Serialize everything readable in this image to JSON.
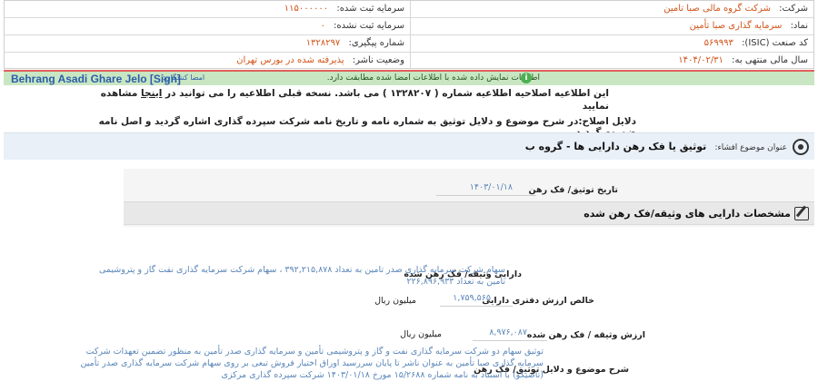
{
  "info": {
    "company_label": "شرکت:",
    "company_value": "شرکت گروه مالی صبا تامین",
    "symbol_label": "نماد:",
    "symbol_value": "سرمایه گذاری صبا تأمین",
    "isic_label": "کد صنعت (ISIC):",
    "isic_value": "۵۶۹۹۹۳",
    "fiscal_label": "سال مالی منتهی به:",
    "fiscal_value": "۱۴۰۴/۰۲/۳۱",
    "reg_capital_label": "سرمایه ثبت شده:",
    "reg_capital_value": "۱۱۵۰۰۰۰۰۰",
    "unreg_capital_label": "سرمایه ثبت نشده:",
    "unreg_capital_value": "۰",
    "tracking_label": "شماره پیگیری:",
    "tracking_value": "۱۳۲۸۲۹۷",
    "publisher_label": "وضعیت ناشر:",
    "publisher_value": "پذیرفته شده در بورس تهران"
  },
  "signature": {
    "name": "Behrang Asadi Ghare Jelo [Sign]",
    "label": "امضا کنندگان:",
    "message": "اطلاعات نمایش داده شده با اطلاعات امضا شده مطابقت دارد."
  },
  "correction": {
    "text_before": "این اطلاعیه اصلاحیه اطلاعیه شماره ( ۱۳۲۸۲۰۷ ) می باشد. نسخه قبلی اطلاعیه را می توانید در",
    "link": "اینجا",
    "text_after": "مشاهده نمایید"
  },
  "reasons": "دلایل اصلاح:در شرح موضوع و دلایل توثیق به شماره نامه و تاریخ نامه شرکت سپرده گذاری اشاره گردید و اصل نامه ضمیمه گردید.",
  "subject": {
    "label": "عنوان موضوع افشاء:",
    "title": "توثیق یا فک رهن دارایی ها - گروه ب"
  },
  "fields": {
    "date_label": "تاریخ توثیق/ فک رهن",
    "date_value": "۱۴۰۳/۰۱/۱۸",
    "section_title": "مشخصات دارایی های وثیقه/فک رهن شده",
    "asset_label": "دارایی وثیقه/ فک رهن شده",
    "asset_value_line1": "سهام شرکت سرمایه گذاری صدر تامین به تعداد ۳۹۲,۲۱۵,۸۷۸ ، سهام شرکت سرمایه گذاری نفت گاز و پتروشیمی",
    "asset_value_line2": "تامین به تعداد ۲۲۶,۸۹۶,۹۳۳",
    "net_book_label": "خالص ارزش دفتری دارایی",
    "net_book_value": "۱,۷۵۹,۵۶۵",
    "net_book_unit": "میلیون ریال",
    "collateral_label": "ارزش وثیقه / فک رهن شده",
    "collateral_value": "۸,۹۷۶,۰۸۷",
    "collateral_unit": "میلیون ریال",
    "desc_label": "شرح موضوع و دلایل توثیق/ فک رهن",
    "desc_line1": "توثیق سهام دو شرکت سرمایه گذاری نفت و گاز و پتروشیمی تأمین و سرمایه گذاری صدر تأمین به منظور تضمین تعهدات شرکت",
    "desc_line2": "سرمایه گذاری صبا تأمین به عنوان ناشر تا پایان سررسید اوراق اختیار فروش تبعی بر روی سهام شرکت سرمایه گذاری صدر تأمین",
    "desc_line3": "(تاصیکو) با استناد به نامه شماره ۱۵/۲۶۸۸ مورخ ۱۴۰۳/۰۱/۱۸ شرکت سپرده گذاری مرکزی"
  }
}
